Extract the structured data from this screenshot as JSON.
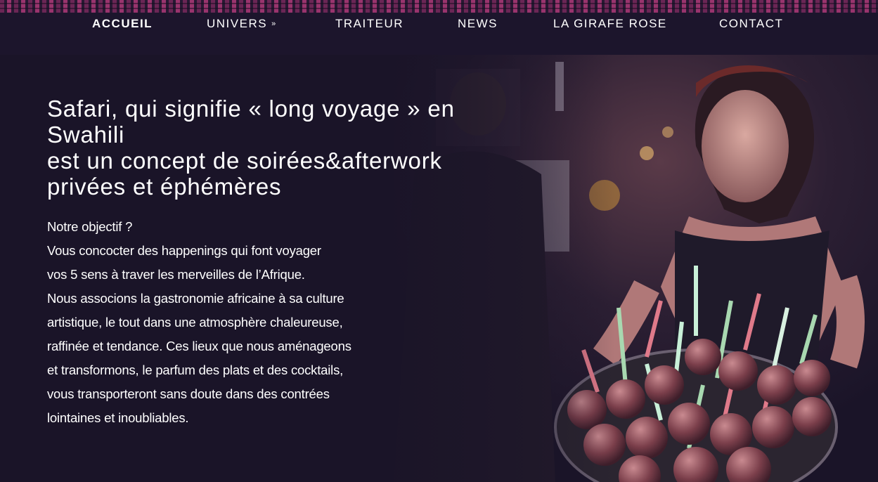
{
  "nav": {
    "items": [
      {
        "label": "ACCUEIL",
        "active": true
      },
      {
        "label": "UNIVERS",
        "has_dropdown": true,
        "dropdown_icon": "double-chevron-down-icon"
      },
      {
        "label": "TRAITEUR"
      },
      {
        "label": "NEWS"
      },
      {
        "label": "LA GIRAFE ROSE"
      },
      {
        "label": "CONTACT"
      }
    ]
  },
  "hero": {
    "headline_lines": [
      "Safari, qui signifie « long voyage » en",
      "Swahili",
      "est un concept de soirées&afterwork",
      "privées et éphémères"
    ],
    "body_lines": [
      "Notre objectif ?",
      "Vous concocter des happenings qui font voyager",
      "vos 5 sens à traver les merveilles de l’Afrique.",
      "Nous associons la gastronomie africaine à sa culture",
      "artistique, le tout dans une atmosphère chaleureuse,",
      "raffinée et tendance. Ces lieux que nous aménageons",
      "et transformons, le parfum des plats et des cocktails,",
      "vous transporteront sans doute dans des contrées",
      "lointaines et inoubliables."
    ]
  },
  "colors": {
    "background": "#1a1428",
    "nav_background": "#1c162c",
    "pattern_accent": "#b03a7a",
    "text": "#ffffff"
  }
}
